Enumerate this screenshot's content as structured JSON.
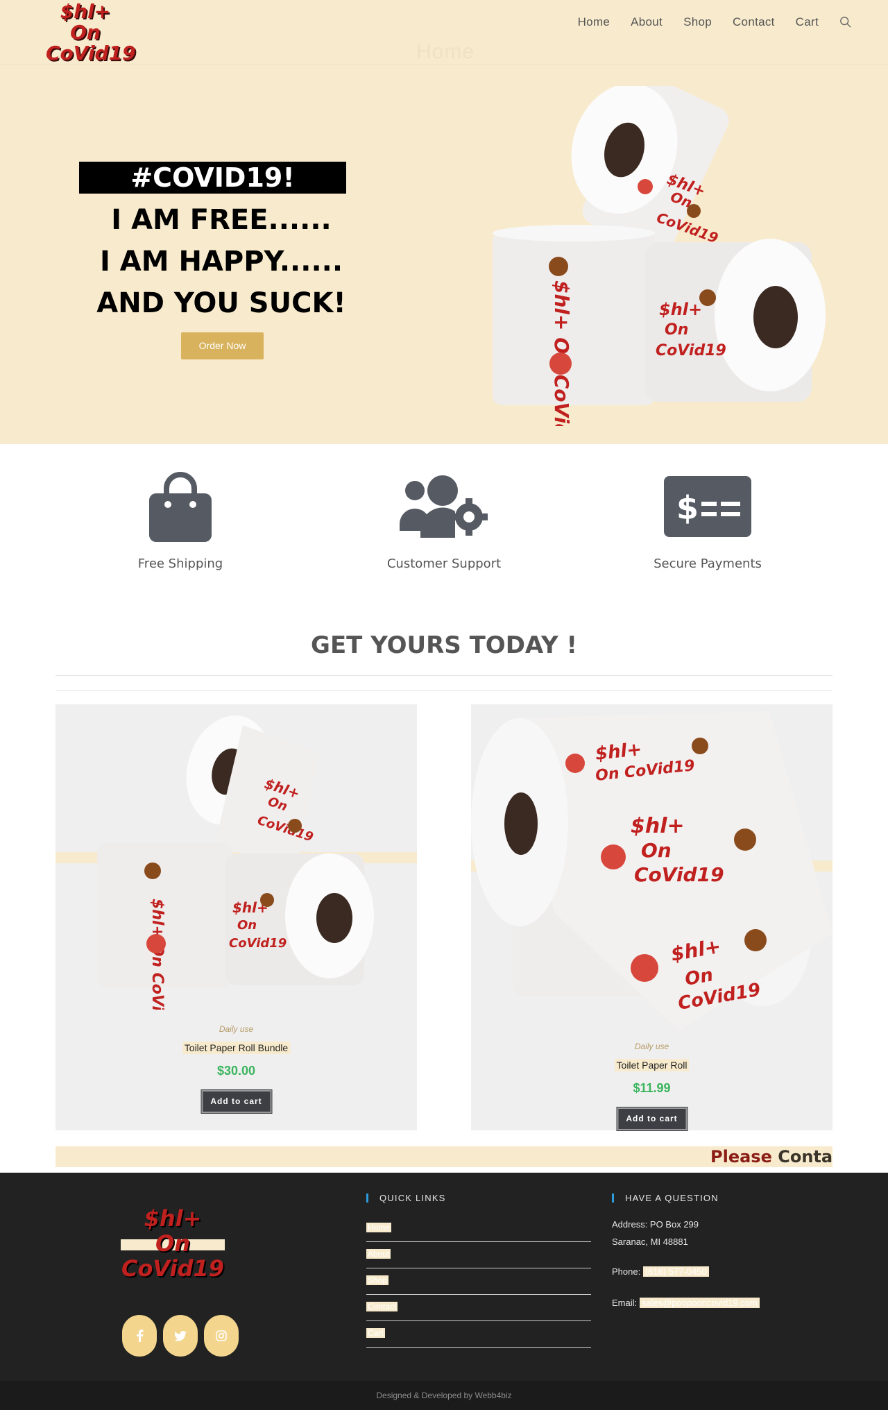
{
  "header": {
    "logo_lines": [
      "$hl+",
      "On",
      "CoVid19"
    ],
    "nav": [
      "Home",
      "About",
      "Shop",
      "Contact",
      "Cart"
    ],
    "search_icon": "search-icon",
    "ghost_title": "Home"
  },
  "hero": {
    "tag": "#COVID19!",
    "lines": [
      "I AM FREE......",
      "I AM HAPPY......",
      "AND YOU SUCK!"
    ],
    "button": "Order Now"
  },
  "features": [
    {
      "label": "Free Shipping",
      "icon": "shopping-bag-icon"
    },
    {
      "label": "Customer Support",
      "icon": "users-cog-icon"
    },
    {
      "label": "Secure Payments",
      "icon": "money-check-icon"
    }
  ],
  "section_title": "GET YOURS TODAY !",
  "products": [
    {
      "category": "Daily use",
      "name": "Toilet Paper Roll Bundle",
      "price": "$30.00",
      "button": "Add to cart"
    },
    {
      "category": "Daily use",
      "name": "Toilet Paper Roll",
      "price": "$11.99",
      "button": "Add to cart"
    }
  ],
  "marquee": {
    "part1": "Please ",
    "part2": "Contac"
  },
  "footer": {
    "logo_lines": [
      "$hl+",
      "On",
      "CoVid19"
    ],
    "social_icons": [
      "facebook-icon",
      "twitter-icon",
      "instagram-icon"
    ],
    "quick_links_title": "QUICK LINKS",
    "quick_links": [
      "Home",
      "About",
      "Shop",
      "Contact",
      "Cart"
    ],
    "question_title": "HAVE A QUESTION",
    "address_line1": "Address: PO Box 299",
    "address_line2": "Saranac, MI 48881",
    "phone_label": "Phone: ",
    "phone": "(616) 577-0450",
    "email_label": "Email: ",
    "email": "sales@poopooncovid19.com"
  },
  "copyright": "Designed & Developed by Webb4biz",
  "colors": {
    "cream": "#f8ebcd",
    "gold": "#d8b25c",
    "price_green": "#3bb55e",
    "logo_red": "#c0211f",
    "footer_bg": "#222222",
    "icon_gray": "#555a63"
  }
}
